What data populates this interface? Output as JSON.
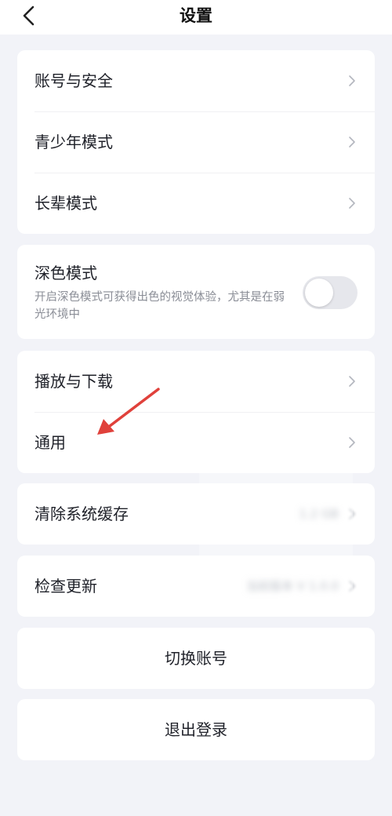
{
  "header": {
    "title": "设置"
  },
  "account_group": {
    "items": [
      {
        "label": "账号与安全"
      },
      {
        "label": "青少年模式"
      },
      {
        "label": "长辈模式"
      }
    ]
  },
  "dark_mode": {
    "title": "深色模式",
    "description": "开启深色模式可获得出色的视觉体验，尤其是在弱光环境中",
    "enabled": false
  },
  "media_group": {
    "items": [
      {
        "label": "播放与下载"
      },
      {
        "label": "通用"
      }
    ]
  },
  "cache": {
    "label": "清除系统缓存",
    "value": "1.2 GB"
  },
  "update": {
    "label": "检查更新",
    "value": "当前版本 V 1.0.0"
  },
  "actions": {
    "switch_account": "切换账号",
    "logout": "退出登录"
  },
  "colors": {
    "background": "#f2f3f8",
    "card": "#ffffff",
    "arrow": "#e0413b"
  },
  "icons": {
    "back": "chevron-left-icon",
    "row": "chevron-right-icon",
    "annotation": "red-arrow-icon"
  }
}
